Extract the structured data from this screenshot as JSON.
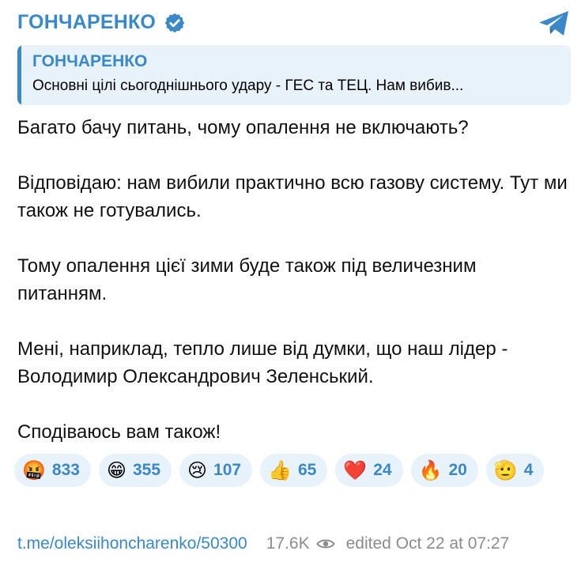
{
  "header": {
    "channel_name": "ГОНЧАРЕНКО",
    "verified_icon": "verified-badge-icon",
    "app_logo": "telegram-icon"
  },
  "quote": {
    "title": "ГОНЧАРЕНКО",
    "text": "Основні цілі сьогоднішнього удару - ГЕС та ТЕЦ. Нам вибив..."
  },
  "message": {
    "paragraphs": [
      "Багато бачу питань, чому опалення не включають?",
      "Відповідаю: нам вибили практично всю газову систему. Тут ми також не готувались.",
      "Тому опалення цієї зими буде також під величезним питанням.",
      "Мені, наприклад, тепло лише від думки, що наш лідер - Володимир Олександрович Зеленський.",
      "Сподіваюсь вам також!"
    ]
  },
  "reactions": [
    {
      "emoji": "🤬",
      "count": "833"
    },
    {
      "emoji": "😁",
      "count": "355"
    },
    {
      "emoji": "😢",
      "count": "107"
    },
    {
      "emoji": "👍",
      "count": "65"
    },
    {
      "emoji": "❤️",
      "count": "24"
    },
    {
      "emoji": "🔥",
      "count": "20"
    },
    {
      "emoji": "🫡",
      "count": "4"
    }
  ],
  "footer": {
    "link": "t.me/oleksiihoncharenko/50300",
    "views": "17.6K",
    "views_icon": "eye-icon",
    "edited": "edited  Oct 22 at 07:27"
  },
  "colors": {
    "accent": "#3a88c8",
    "quote_bg": "#e8f2fb",
    "muted": "#8c8c8c"
  }
}
